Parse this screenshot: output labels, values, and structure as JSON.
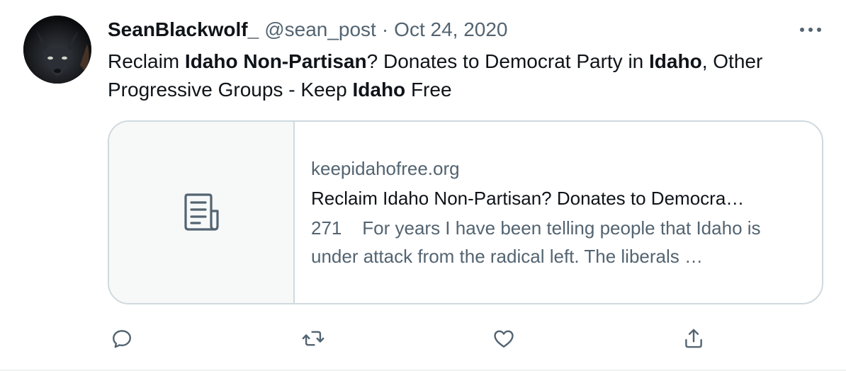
{
  "tweet": {
    "author": {
      "display_name": "SeanBlackwolf_",
      "handle": "@sean_post",
      "avatar_icon": "wolf-avatar"
    },
    "separator": "·",
    "date": "Oct 24, 2020",
    "more_icon": "more-horizontal-icon",
    "text_segments": [
      {
        "text": "Reclaim ",
        "bold": false
      },
      {
        "text": "Idaho Non-Partisan",
        "bold": true
      },
      {
        "text": "? Donates to Democrat Party in ",
        "bold": false
      },
      {
        "text": "Idaho",
        "bold": true
      },
      {
        "text": ", Other Progressive Groups - Keep ",
        "bold": false
      },
      {
        "text": "Idaho",
        "bold": true
      },
      {
        "text": " Free",
        "bold": false
      }
    ],
    "card": {
      "thumbnail_icon": "article-icon",
      "domain": "keepidahofree.org",
      "title": "Reclaim Idaho Non-Partisan? Donates to Democra…",
      "description": "271    For years I have been telling people that Idaho is under attack from the radical left. The liberals …"
    },
    "actions": [
      {
        "name": "reply",
        "icon": "reply-icon"
      },
      {
        "name": "retweet",
        "icon": "retweet-icon"
      },
      {
        "name": "like",
        "icon": "heart-icon"
      },
      {
        "name": "share",
        "icon": "share-icon"
      }
    ]
  },
  "colors": {
    "primary_text": "#0f1419",
    "secondary_text": "#536471",
    "border": "#cfd9de",
    "thumb_bg": "#f7f9f9"
  }
}
